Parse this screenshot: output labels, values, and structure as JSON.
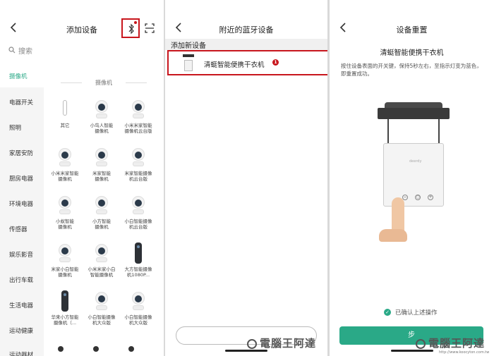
{
  "panel1": {
    "title": "添加设备",
    "search_placeholder": "搜索",
    "sidebar": [
      "摄像机",
      "电器开关",
      "照明",
      "家居安防",
      "厨房电器",
      "环境电器",
      "传感器",
      "娱乐影音",
      "出行车载",
      "生活电器",
      "运动健康",
      "运动器材"
    ],
    "section": "摄像机",
    "devices": [
      "其它",
      "小鸟人智能\n摄像机",
      "小米米家智能\n摄像机云台版",
      "小米米家智能\n摄像机",
      "米家智能\n摄像机",
      "米家智能摄像\n机云台版",
      "小蚁智能\n摄像机",
      "小方智能\n摄像机",
      "小白智能摄像\n机云台版",
      "米家小白智能\n摄像机",
      "小米米家小白\n智能摄像机",
      "大方智能摄像\n机1080P...",
      "华来小方智能\n摄像机（...",
      "小白智能摄像\n机大众版",
      "小白智能摄像\n机大众版"
    ]
  },
  "panel2": {
    "title": "附近的蓝牙设备",
    "subhead": "添加新设备",
    "device_name": "清蜓智能便携干衣机",
    "badge": "1"
  },
  "panel3": {
    "title": "设备重置",
    "device_name": "清蜓智能便携干衣机",
    "instructions": "按住设备表面的开关键，保持5秒左右，至指示灯变为蓝色，即重置成功。",
    "dryer_brand": "deerdy",
    "confirm": "已确认上述操作",
    "next": "步"
  },
  "watermark": {
    "text": "電腦王阿達",
    "url": "http://www.koocyton.com.tw"
  },
  "colors": {
    "accent": "#2aa987",
    "highlight": "#c8161d"
  }
}
